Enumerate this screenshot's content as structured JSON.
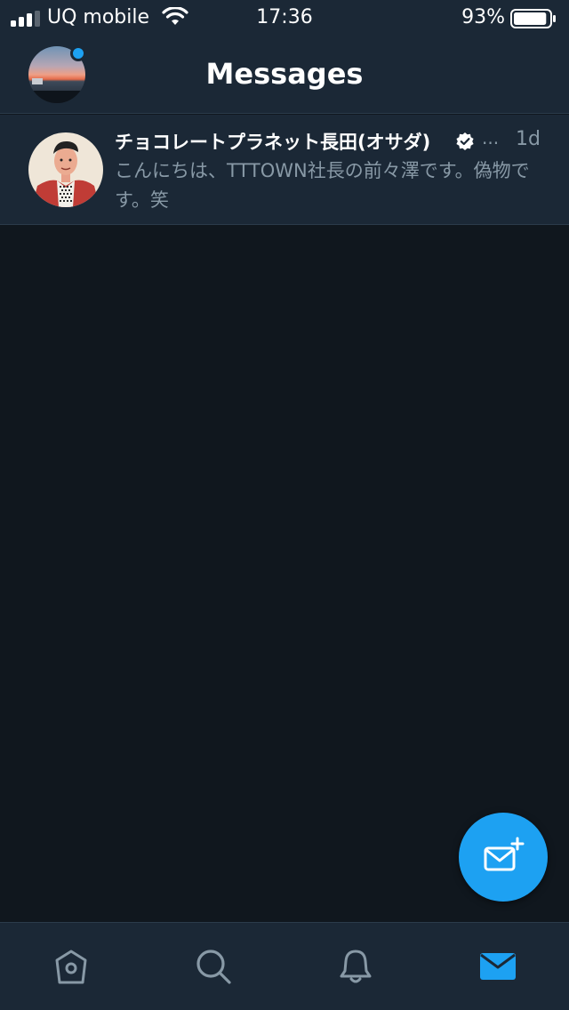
{
  "status_bar": {
    "carrier": "UQ mobile",
    "time": "17:36",
    "battery_percent": "93%",
    "battery_level": 0.93
  },
  "nav": {
    "title": "Messages",
    "has_notification_dot": true
  },
  "messages": [
    {
      "name": "チョコレートプラネット長田(オサダ)",
      "verified": true,
      "ellipsis": "...",
      "time": "1d",
      "preview": "こんにちは、TTTOWN社長の前々澤です。偽物です。笑"
    }
  ],
  "tabs": [
    {
      "icon": "home-icon",
      "active": false
    },
    {
      "icon": "search-icon",
      "active": false
    },
    {
      "icon": "bell-icon",
      "active": false
    },
    {
      "icon": "mail-icon",
      "active": true
    }
  ],
  "colors": {
    "background": "#10171e",
    "surface": "#1b2836",
    "divider": "#2b3b4b",
    "accent": "#1da1f2",
    "secondary_text": "#8899a6",
    "primary_text": "#ffffff"
  }
}
